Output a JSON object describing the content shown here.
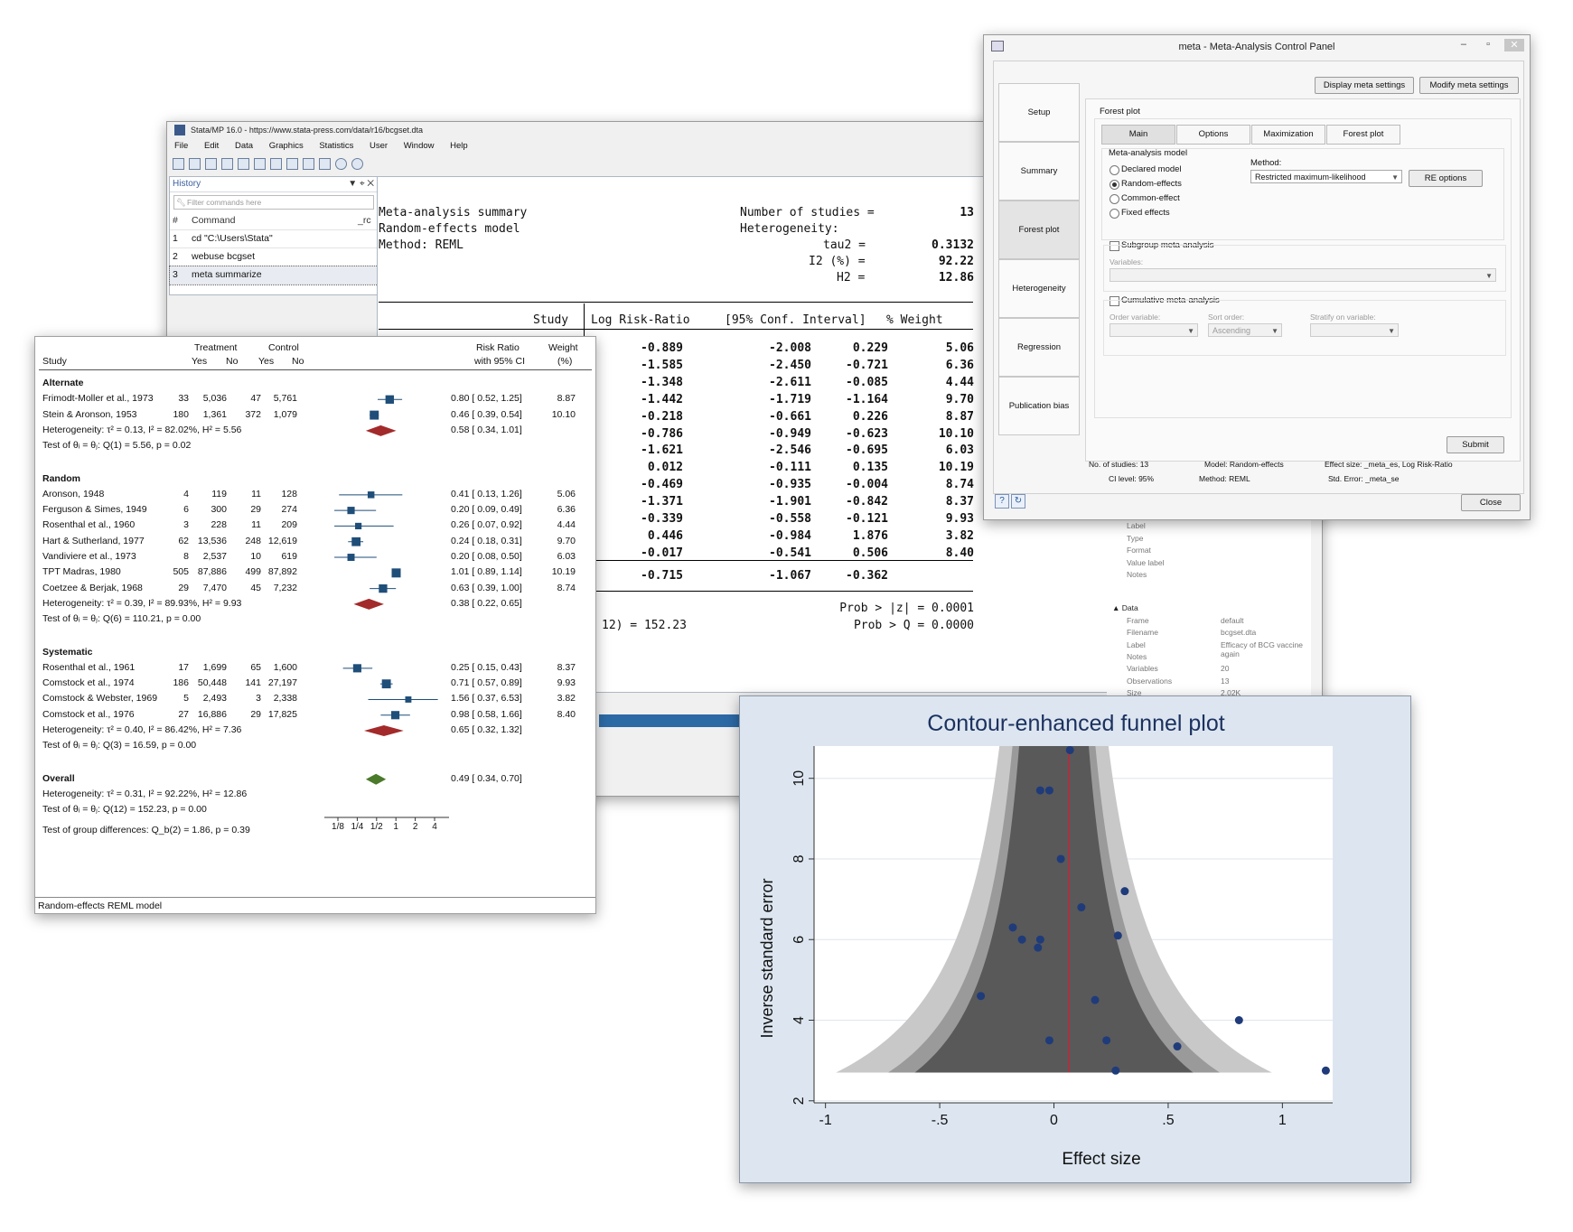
{
  "stata": {
    "title": "Stata/MP 16.0 - https://www.stata-press.com/data/r16/bcgset.dta",
    "menu": [
      "File",
      "Edit",
      "Data",
      "Graphics",
      "Statistics",
      "User",
      "Window",
      "Help"
    ],
    "history": {
      "title": "History",
      "filter_placeholder": "Filter commands here",
      "col_num": "#",
      "col_command": "Command",
      "col_rc": "_rc",
      "items": [
        {
          "n": "1",
          "cmd": "cd \"C:\\Users\\Stata\""
        },
        {
          "n": "2",
          "cmd": "webuse bcgset"
        },
        {
          "n": "3",
          "cmd": "meta summarize"
        }
      ]
    },
    "results": {
      "summary_title": "Meta-analysis summary",
      "model": "Random-effects model",
      "method": "Method: REML",
      "nstudies_label": "Number of studies =",
      "nstudies": "13",
      "heterogeneity_label": "Heterogeneity:",
      "tau2_label": "tau2 =",
      "tau2": "0.3132",
      "i2_label": "I2 (%) =",
      "i2": "92.22",
      "h2_label": "H2 =",
      "h2": "12.86",
      "headers": [
        "Study",
        "Log Risk-Ratio",
        "[95% Conf. Interval]",
        "% Weight"
      ],
      "rows": [
        [
          "-0.889",
          "-2.008",
          "0.229",
          "5.06"
        ],
        [
          "-1.585",
          "-2.450",
          "-0.721",
          "6.36"
        ],
        [
          "-1.348",
          "-2.611",
          "-0.085",
          "4.44"
        ],
        [
          "-1.442",
          "-1.719",
          "-1.164",
          "9.70"
        ],
        [
          "-0.218",
          "-0.661",
          "0.226",
          "8.87"
        ],
        [
          "-0.786",
          "-0.949",
          "-0.623",
          "10.10"
        ],
        [
          "-1.621",
          "-2.546",
          "-0.695",
          "6.03"
        ],
        [
          "0.012",
          "-0.111",
          "0.135",
          "10.19"
        ],
        [
          "-0.469",
          "-0.935",
          "-0.004",
          "8.74"
        ],
        [
          "-1.371",
          "-1.901",
          "-0.842",
          "8.37"
        ],
        [
          "-0.339",
          "-0.558",
          "-0.121",
          "9.93"
        ],
        [
          "0.446",
          "-0.984",
          "1.876",
          "3.82"
        ],
        [
          "-0.017",
          "-0.541",
          "0.506",
          "8.40"
        ]
      ],
      "theta": [
        "-0.715",
        "-1.067",
        "-0.362"
      ],
      "q_stat": "12) = 152.23",
      "prob_z": "Prob > |z| = 0.0001",
      "prob_q": "Prob > Q = 0.0000"
    },
    "properties": {
      "var_rows": [
        "Label",
        "Type",
        "Format",
        "Value label",
        "Notes"
      ],
      "data_section": "Data",
      "data_rows": [
        {
          "k": "Frame",
          "v": "default"
        },
        {
          "k": "Filename",
          "v": "bcgset.dta"
        },
        {
          "k": "Label",
          "v": "Efficacy of BCG vaccine again"
        },
        {
          "k": "Notes",
          "v": ""
        },
        {
          "k": "Variables",
          "v": "20"
        },
        {
          "k": "Observations",
          "v": "13"
        },
        {
          "k": "Size",
          "v": "2.02K"
        }
      ]
    }
  },
  "forest": {
    "h_treatment": "Treatment",
    "h_control": "Control",
    "h_rr": "Risk Ratio",
    "h_ci": "with 95% CI",
    "h_weight": "Weight",
    "h_pct": "(%)",
    "h_study": "Study",
    "h_yes": "Yes",
    "h_no": "No",
    "groups": [
      {
        "name": "Alternate",
        "studies": [
          {
            "s": "Frimodt-Moller et al., 1973",
            "ty": "33",
            "tn": "5,036",
            "cy": "47",
            "cn": "5,761",
            "ci": "0.80 [  0.52,  1.25]",
            "w": "8.87",
            "rr": 0.8,
            "lo": 0.52,
            "hi": 1.25
          },
          {
            "s": "Stein & Aronson, 1953",
            "ty": "180",
            "tn": "1,361",
            "cy": "372",
            "cn": "1,079",
            "ci": "0.46 [  0.39,  0.54]",
            "w": "10.10",
            "rr": 0.46,
            "lo": 0.39,
            "hi": 0.54
          }
        ],
        "het": "Heterogeneity: τ² = 0.13, I² = 82.02%, H² = 5.56",
        "test": "Test of θᵢ = θⱼ: Q(1) = 5.56, p = 0.02",
        "pooled": {
          "ci": "0.58 [  0.34,  1.01]",
          "rr": 0.58,
          "lo": 0.34,
          "hi": 1.01
        }
      },
      {
        "name": "Random",
        "studies": [
          {
            "s": "Aronson, 1948",
            "ty": "4",
            "tn": "119",
            "cy": "11",
            "cn": "128",
            "ci": "0.41 [  0.13,  1.26]",
            "w": "5.06",
            "rr": 0.41,
            "lo": 0.13,
            "hi": 1.26
          },
          {
            "s": "Ferguson & Simes, 1949",
            "ty": "6",
            "tn": "300",
            "cy": "29",
            "cn": "274",
            "ci": "0.20 [  0.09,  0.49]",
            "w": "6.36",
            "rr": 0.2,
            "lo": 0.09,
            "hi": 0.49
          },
          {
            "s": "Rosenthal et al., 1960",
            "ty": "3",
            "tn": "228",
            "cy": "11",
            "cn": "209",
            "ci": "0.26 [  0.07,  0.92]",
            "w": "4.44",
            "rr": 0.26,
            "lo": 0.07,
            "hi": 0.92
          },
          {
            "s": "Hart & Sutherland, 1977",
            "ty": "62",
            "tn": "13,536",
            "cy": "248",
            "cn": "12,619",
            "ci": "0.24 [  0.18,  0.31]",
            "w": "9.70",
            "rr": 0.24,
            "lo": 0.18,
            "hi": 0.31
          },
          {
            "s": "Vandiviere et al., 1973",
            "ty": "8",
            "tn": "2,537",
            "cy": "10",
            "cn": "619",
            "ci": "0.20 [  0.08,  0.50]",
            "w": "6.03",
            "rr": 0.2,
            "lo": 0.08,
            "hi": 0.5
          },
          {
            "s": "TPT Madras, 1980",
            "ty": "505",
            "tn": "87,886",
            "cy": "499",
            "cn": "87,892",
            "ci": "1.01 [  0.89,  1.14]",
            "w": "10.19",
            "rr": 1.01,
            "lo": 0.89,
            "hi": 1.14
          },
          {
            "s": "Coetzee & Berjak, 1968",
            "ty": "29",
            "tn": "7,470",
            "cy": "45",
            "cn": "7,232",
            "ci": "0.63 [  0.39,  1.00]",
            "w": "8.74",
            "rr": 0.63,
            "lo": 0.39,
            "hi": 1.0
          }
        ],
        "het": "Heterogeneity: τ² = 0.39, I² = 89.93%, H² = 9.93",
        "test": "Test of θᵢ = θⱼ: Q(6) = 110.21, p = 0.00",
        "pooled": {
          "ci": "0.38 [  0.22,  0.65]",
          "rr": 0.38,
          "lo": 0.22,
          "hi": 0.65
        }
      },
      {
        "name": "Systematic",
        "studies": [
          {
            "s": "Rosenthal et al., 1961",
            "ty": "17",
            "tn": "1,699",
            "cy": "65",
            "cn": "1,600",
            "ci": "0.25 [  0.15,  0.43]",
            "w": "8.37",
            "rr": 0.25,
            "lo": 0.15,
            "hi": 0.43
          },
          {
            "s": "Comstock et al., 1974",
            "ty": "186",
            "tn": "50,448",
            "cy": "141",
            "cn": "27,197",
            "ci": "0.71 [  0.57,  0.89]",
            "w": "9.93",
            "rr": 0.71,
            "lo": 0.57,
            "hi": 0.89
          },
          {
            "s": "Comstock & Webster, 1969",
            "ty": "5",
            "tn": "2,493",
            "cy": "3",
            "cn": "2,338",
            "ci": "1.56 [  0.37,  6.53]",
            "w": "3.82",
            "rr": 1.56,
            "lo": 0.37,
            "hi": 6.53
          },
          {
            "s": "Comstock et al., 1976",
            "ty": "27",
            "tn": "16,886",
            "cy": "29",
            "cn": "17,825",
            "ci": "0.98 [  0.58,  1.66]",
            "w": "8.40",
            "rr": 0.98,
            "lo": 0.58,
            "hi": 1.66
          }
        ],
        "het": "Heterogeneity: τ² = 0.40, I² = 86.42%, H² = 7.36",
        "test": "Test of θᵢ = θⱼ: Q(3) = 16.59, p = 0.00",
        "pooled": {
          "ci": "0.65 [  0.32,  1.32]",
          "rr": 0.65,
          "lo": 0.32,
          "hi": 1.32
        }
      }
    ],
    "overall": {
      "name": "Overall",
      "ci": "0.49 [  0.34,  0.70]",
      "rr": 0.49,
      "lo": 0.34,
      "hi": 0.7,
      "het": "Heterogeneity: τ² = 0.31, I² = 92.22%, H² = 12.86",
      "test": "Test of θᵢ = θⱼ: Q(12) = 152.23, p = 0.00"
    },
    "group_diff": "Test of group differences: Q_b(2) = 1.86, p = 0.39",
    "ticks": [
      "1/8",
      "1/4",
      "1/2",
      "1",
      "2",
      "4"
    ],
    "tick_values": [
      0.125,
      0.25,
      0.5,
      1,
      2,
      4
    ],
    "footer": "Random-effects REML model",
    "colors": {
      "study": "#1f4e79",
      "subgroup": "#a32a2a",
      "overall": "#4a7a2a"
    }
  },
  "meta_panel": {
    "title": "meta - Meta-Analysis Control Panel",
    "display_btn": "Display meta settings",
    "modify_btn": "Modify meta settings",
    "nav": [
      "Setup",
      "Summary",
      "Forest plot",
      "Heterogeneity",
      "Regression",
      "Publication bias"
    ],
    "active_nav": "Forest plot",
    "section": "Forest plot",
    "tabs": [
      "Main",
      "Options",
      "Maximization",
      "Forest plot"
    ],
    "model_group": "Meta-analysis model",
    "models": [
      "Declared model",
      "Random-effects",
      "Common-effect",
      "Fixed effects"
    ],
    "selected_model": "Random-effects",
    "method_label": "Method:",
    "method_value": "Restricted maximum-likelihood",
    "re_options": "RE options",
    "subgroup_label": "Subgroup meta-analysis",
    "variables_label": "Variables:",
    "cumulative_label": "Cumulative meta-analysis",
    "order_label": "Order variable:",
    "sort_label": "Sort order:",
    "sort_value": "Ascending",
    "stratify_label": "Stratify on variable:",
    "submit": "Submit",
    "close": "Close",
    "info": {
      "nstudies": "No. of studies: 13",
      "cilevel": "CI level: 95%",
      "model": "Model: Random-effects",
      "method": "Method: REML",
      "effect": "Effect size: _meta_es, Log Risk-Ratio",
      "stderr": "Std. Error: _meta_se"
    }
  },
  "chart_data": {
    "type": "scatter",
    "title": "Contour-enhanced funnel plot",
    "xlabel": "Effect size",
    "ylabel": "Inverse standard error",
    "x_ticks": [
      "-1",
      "-.5",
      "0",
      ".5",
      "1"
    ],
    "x_tick_values": [
      -1,
      -0.5,
      0,
      0.5,
      1
    ],
    "y_ticks": [
      "2",
      "4",
      "6",
      "8",
      "10"
    ],
    "y_tick_values": [
      2,
      4,
      6,
      8,
      10
    ],
    "xlim": [
      -1.05,
      1.22
    ],
    "ylim": [
      1.95,
      10.8
    ],
    "grid": true,
    "reference_line_x": 0.065,
    "contour_colors": [
      "#c8c8c8",
      "#9a9a9a",
      "#595959"
    ],
    "point_color": "#1f3b7a",
    "line_color": "#c0283a",
    "points": [
      {
        "x": 0.07,
        "y": 10.7
      },
      {
        "x": -0.06,
        "y": 9.7
      },
      {
        "x": -0.02,
        "y": 9.7
      },
      {
        "x": 0.03,
        "y": 8.0
      },
      {
        "x": 0.31,
        "y": 7.2
      },
      {
        "x": 0.12,
        "y": 6.8
      },
      {
        "x": -0.18,
        "y": 6.3
      },
      {
        "x": -0.14,
        "y": 6.0
      },
      {
        "x": -0.06,
        "y": 6.0
      },
      {
        "x": -0.07,
        "y": 5.8
      },
      {
        "x": 0.28,
        "y": 6.1
      },
      {
        "x": -0.32,
        "y": 4.6
      },
      {
        "x": 0.18,
        "y": 4.5
      },
      {
        "x": 0.81,
        "y": 4.0
      },
      {
        "x": -0.02,
        "y": 3.5
      },
      {
        "x": 0.23,
        "y": 3.5
      },
      {
        "x": 0.54,
        "y": 3.35
      },
      {
        "x": 0.27,
        "y": 2.75
      },
      {
        "x": 1.19,
        "y": 2.75
      }
    ]
  }
}
